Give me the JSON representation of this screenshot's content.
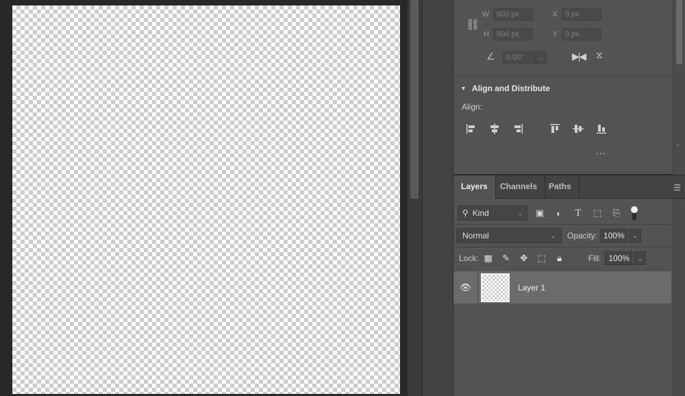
{
  "properties": {
    "width_label": "W",
    "width_value": "600 px",
    "height_label": "H",
    "height_value": "600 px",
    "x_label": "X",
    "x_value": "0 px",
    "y_label": "Y",
    "y_value": "0 px",
    "angle_value": "0.00°",
    "align_section_title": "Align and Distribute",
    "align_label": "Align:",
    "more_label": "...",
    "icons": [
      "link-icon",
      "angle-icon",
      "flip-horizontal-icon",
      "flip-vertical-icon"
    ]
  },
  "layers_panel": {
    "tabs": [
      "Layers",
      "Channels",
      "Paths"
    ],
    "active_tab": "Layers",
    "filter": {
      "kind_label": "Kind",
      "icons": [
        "image-filter-icon",
        "adjustment-filter-icon",
        "type-filter-icon",
        "shape-filter-icon",
        "smart-object-filter-icon",
        "filter-toggle-icon"
      ]
    },
    "blend_mode": "Normal",
    "opacity_label": "Opacity:",
    "opacity_value": "100%",
    "lock_label": "Lock:",
    "fill_label": "Fill:",
    "fill_value": "100%",
    "layers": [
      {
        "name": "Layer 1",
        "visible": true,
        "selected": true
      }
    ]
  },
  "colors": {
    "workspace_bg": "#282828",
    "panel_bg": "#535353",
    "selected_layer_bg": "#6b6b6b",
    "tab_bar_bg": "#434343"
  }
}
